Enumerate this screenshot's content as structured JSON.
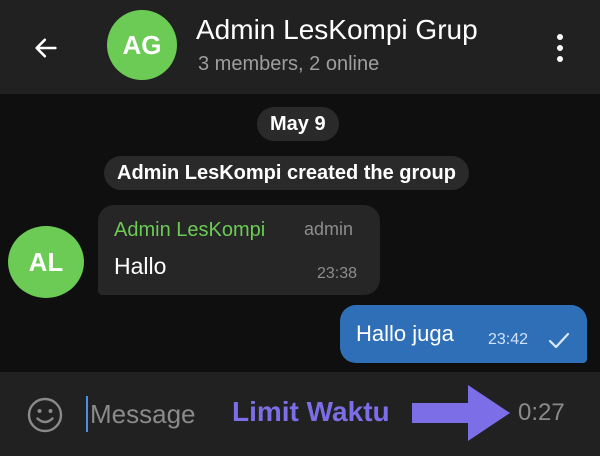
{
  "header": {
    "avatar_initials": "AG",
    "title": "Admin LesKompi Grup",
    "subtitle": "3 members, 2 online",
    "back_icon": "arrow-left-icon",
    "menu_icon": "more-vertical-icon"
  },
  "chat": {
    "date_label": "May 9",
    "service_message": "Admin LesKompi created the group",
    "incoming": {
      "avatar_initials": "AL",
      "sender": "Admin LesKompi",
      "role": "admin",
      "text": "Hallo",
      "time": "23:38"
    },
    "outgoing": {
      "text": "Hallo juga",
      "time": "23:42",
      "status_icon": "check-icon"
    }
  },
  "composer": {
    "placeholder": "Message",
    "timer": "0:27",
    "emoji_icon": "smile-icon"
  },
  "annotation": {
    "label": "Limit Waktu",
    "arrow_icon": "arrow-right-icon"
  },
  "colors": {
    "header_bg": "#212121",
    "chat_bg": "#0f0f0f",
    "avatar_green": "#6bcb55",
    "bubble_in": "#262626",
    "bubble_out": "#2f6fb8",
    "annotation": "#7b6ee6"
  }
}
